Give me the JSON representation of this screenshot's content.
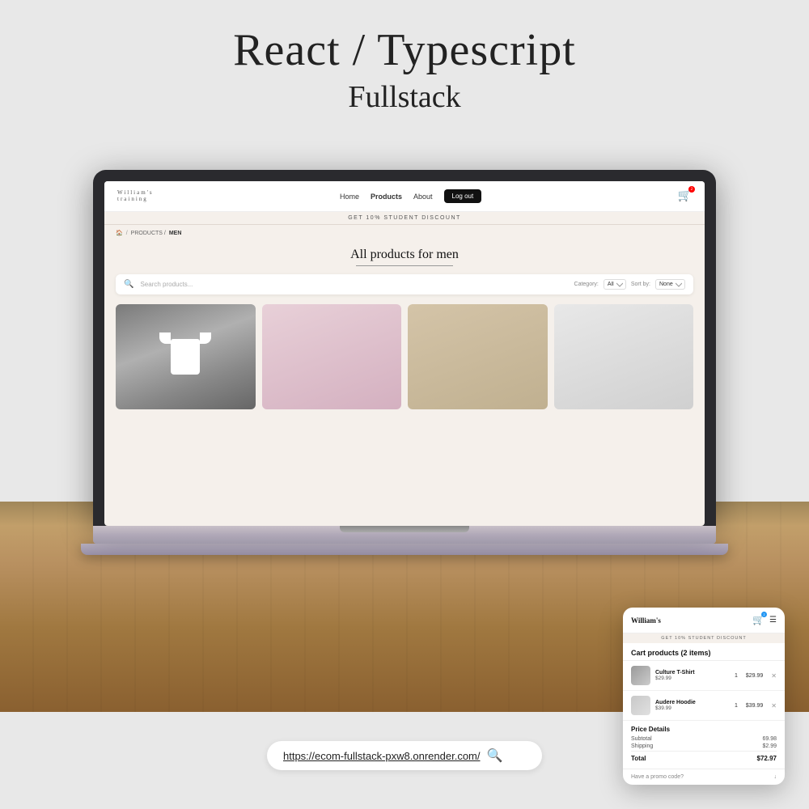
{
  "page": {
    "title": "React / Typescript",
    "subtitle": "Fullstack",
    "url": "https://ecom-fullstack-pxw8.onrender.com/"
  },
  "site": {
    "logo": {
      "brand": "William's",
      "tagline": "training"
    },
    "nav": {
      "home": "Home",
      "products": "Products",
      "about": "About",
      "logout": "Log out"
    },
    "banner": "GET 10% STUDENT DISCOUNT",
    "breadcrumb": {
      "home": "🏠",
      "sep1": "/",
      "products": "PRODUCTS /",
      "sep2": "",
      "current": "MEN"
    },
    "heading": "All products for men",
    "search": {
      "placeholder": "Search products...",
      "category_label": "Category:",
      "category_default": "All",
      "sort_label": "Sort by:",
      "sort_default": "None"
    }
  },
  "products": [
    {
      "id": 1,
      "type": "shirt-gray"
    },
    {
      "id": 2,
      "type": "pink-man"
    },
    {
      "id": 3,
      "type": "hoodie-man"
    },
    {
      "id": 4,
      "type": "white-man"
    }
  ],
  "mobile": {
    "logo": "William's",
    "banner": "GET 10% STUDENT DISCOUNT",
    "cart_title": "Cart products (2 items)",
    "items": [
      {
        "name": "Culture T-Shirt",
        "price": "$29.99",
        "qty": "1",
        "total": "$29.99"
      },
      {
        "name": "Audere Hoodie",
        "price": "$39.99",
        "qty": "1",
        "total": "$39.99"
      }
    ],
    "price_details": {
      "title": "Price Details",
      "subtotal_label": "Subtotal",
      "subtotal_value": "69.98",
      "shipping_label": "Shipping",
      "shipping_value": "$2.99",
      "total_label": "Total",
      "total_value": "$72.97"
    },
    "promo": "Have a promo code?"
  },
  "icons": {
    "search": "🔍",
    "cart": "🛒",
    "home": "⌂",
    "menu": "☰",
    "close": "✕",
    "chevron_down": "↓"
  }
}
